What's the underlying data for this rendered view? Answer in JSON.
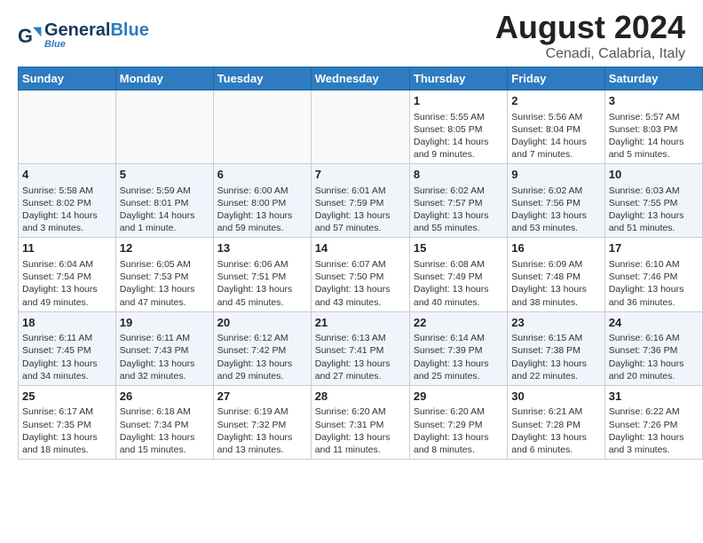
{
  "header": {
    "logo_general": "General",
    "logo_blue": "Blue",
    "month_title": "August 2024",
    "subtitle": "Cenadi, Calabria, Italy"
  },
  "weekdays": [
    "Sunday",
    "Monday",
    "Tuesday",
    "Wednesday",
    "Thursday",
    "Friday",
    "Saturday"
  ],
  "weeks": [
    [
      {
        "day": "",
        "info": ""
      },
      {
        "day": "",
        "info": ""
      },
      {
        "day": "",
        "info": ""
      },
      {
        "day": "",
        "info": ""
      },
      {
        "day": "1",
        "info": "Sunrise: 5:55 AM\nSunset: 8:05 PM\nDaylight: 14 hours\nand 9 minutes."
      },
      {
        "day": "2",
        "info": "Sunrise: 5:56 AM\nSunset: 8:04 PM\nDaylight: 14 hours\nand 7 minutes."
      },
      {
        "day": "3",
        "info": "Sunrise: 5:57 AM\nSunset: 8:03 PM\nDaylight: 14 hours\nand 5 minutes."
      }
    ],
    [
      {
        "day": "4",
        "info": "Sunrise: 5:58 AM\nSunset: 8:02 PM\nDaylight: 14 hours\nand 3 minutes."
      },
      {
        "day": "5",
        "info": "Sunrise: 5:59 AM\nSunset: 8:01 PM\nDaylight: 14 hours\nand 1 minute."
      },
      {
        "day": "6",
        "info": "Sunrise: 6:00 AM\nSunset: 8:00 PM\nDaylight: 13 hours\nand 59 minutes."
      },
      {
        "day": "7",
        "info": "Sunrise: 6:01 AM\nSunset: 7:59 PM\nDaylight: 13 hours\nand 57 minutes."
      },
      {
        "day": "8",
        "info": "Sunrise: 6:02 AM\nSunset: 7:57 PM\nDaylight: 13 hours\nand 55 minutes."
      },
      {
        "day": "9",
        "info": "Sunrise: 6:02 AM\nSunset: 7:56 PM\nDaylight: 13 hours\nand 53 minutes."
      },
      {
        "day": "10",
        "info": "Sunrise: 6:03 AM\nSunset: 7:55 PM\nDaylight: 13 hours\nand 51 minutes."
      }
    ],
    [
      {
        "day": "11",
        "info": "Sunrise: 6:04 AM\nSunset: 7:54 PM\nDaylight: 13 hours\nand 49 minutes."
      },
      {
        "day": "12",
        "info": "Sunrise: 6:05 AM\nSunset: 7:53 PM\nDaylight: 13 hours\nand 47 minutes."
      },
      {
        "day": "13",
        "info": "Sunrise: 6:06 AM\nSunset: 7:51 PM\nDaylight: 13 hours\nand 45 minutes."
      },
      {
        "day": "14",
        "info": "Sunrise: 6:07 AM\nSunset: 7:50 PM\nDaylight: 13 hours\nand 43 minutes."
      },
      {
        "day": "15",
        "info": "Sunrise: 6:08 AM\nSunset: 7:49 PM\nDaylight: 13 hours\nand 40 minutes."
      },
      {
        "day": "16",
        "info": "Sunrise: 6:09 AM\nSunset: 7:48 PM\nDaylight: 13 hours\nand 38 minutes."
      },
      {
        "day": "17",
        "info": "Sunrise: 6:10 AM\nSunset: 7:46 PM\nDaylight: 13 hours\nand 36 minutes."
      }
    ],
    [
      {
        "day": "18",
        "info": "Sunrise: 6:11 AM\nSunset: 7:45 PM\nDaylight: 13 hours\nand 34 minutes."
      },
      {
        "day": "19",
        "info": "Sunrise: 6:11 AM\nSunset: 7:43 PM\nDaylight: 13 hours\nand 32 minutes."
      },
      {
        "day": "20",
        "info": "Sunrise: 6:12 AM\nSunset: 7:42 PM\nDaylight: 13 hours\nand 29 minutes."
      },
      {
        "day": "21",
        "info": "Sunrise: 6:13 AM\nSunset: 7:41 PM\nDaylight: 13 hours\nand 27 minutes."
      },
      {
        "day": "22",
        "info": "Sunrise: 6:14 AM\nSunset: 7:39 PM\nDaylight: 13 hours\nand 25 minutes."
      },
      {
        "day": "23",
        "info": "Sunrise: 6:15 AM\nSunset: 7:38 PM\nDaylight: 13 hours\nand 22 minutes."
      },
      {
        "day": "24",
        "info": "Sunrise: 6:16 AM\nSunset: 7:36 PM\nDaylight: 13 hours\nand 20 minutes."
      }
    ],
    [
      {
        "day": "25",
        "info": "Sunrise: 6:17 AM\nSunset: 7:35 PM\nDaylight: 13 hours\nand 18 minutes."
      },
      {
        "day": "26",
        "info": "Sunrise: 6:18 AM\nSunset: 7:34 PM\nDaylight: 13 hours\nand 15 minutes."
      },
      {
        "day": "27",
        "info": "Sunrise: 6:19 AM\nSunset: 7:32 PM\nDaylight: 13 hours\nand 13 minutes."
      },
      {
        "day": "28",
        "info": "Sunrise: 6:20 AM\nSunset: 7:31 PM\nDaylight: 13 hours\nand 11 minutes."
      },
      {
        "day": "29",
        "info": "Sunrise: 6:20 AM\nSunset: 7:29 PM\nDaylight: 13 hours\nand 8 minutes."
      },
      {
        "day": "30",
        "info": "Sunrise: 6:21 AM\nSunset: 7:28 PM\nDaylight: 13 hours\nand 6 minutes."
      },
      {
        "day": "31",
        "info": "Sunrise: 6:22 AM\nSunset: 7:26 PM\nDaylight: 13 hours\nand 3 minutes."
      }
    ]
  ]
}
